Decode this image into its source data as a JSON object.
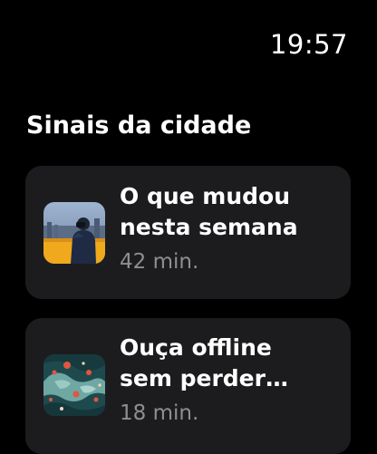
{
  "status": {
    "time": "19:57"
  },
  "section": {
    "title": "Sinais da cidade"
  },
  "items": [
    {
      "title_line1": "O que mudou",
      "title_line2": "nesta semana",
      "duration": "42 min.",
      "thumbnail": "person-with-binoculars-city-thumbnail"
    },
    {
      "title_line1": "Ouça offline",
      "title_line2": "sem perder…",
      "duration": "18 min.",
      "thumbnail": "teal-map-collage-thumbnail"
    }
  ],
  "colors": {
    "background": "#000000",
    "card": "#1c1c1e",
    "primary_text": "#ffffff",
    "secondary_text": "#8e8e93"
  }
}
